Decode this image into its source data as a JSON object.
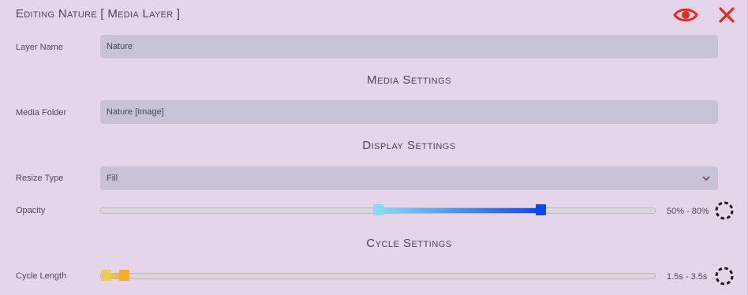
{
  "header": {
    "title": "Editing Nature [ Media Layer ]",
    "eye_icon": "eye-icon",
    "close_icon": "close-icon",
    "accent_color": "#e8291c"
  },
  "layer_name": {
    "label": "Layer Name",
    "value": "Nature"
  },
  "media_settings": {
    "title": "Media Settings",
    "media_folder": {
      "label": "Media Folder",
      "value": "Nature [Image]"
    }
  },
  "display_settings": {
    "title": "Display Settings",
    "resize_type": {
      "label": "Resize Type",
      "value": "Fill",
      "icon": "chevron-down-icon"
    },
    "opacity": {
      "label": "Opacity",
      "value_text": "50% - 80%",
      "min": 0,
      "max": 100,
      "low": 50,
      "high": 80,
      "low_color": "#86dcf4",
      "high_color": "#1146ee",
      "random_icon": "randomize-icon"
    }
  },
  "cycle_settings": {
    "title": "Cycle Settings",
    "cycle_length": {
      "label": "Cycle Length",
      "value_text": "1.5s - 3.5s",
      "low_fraction": 0.0,
      "high_fraction": 0.034,
      "low_color": "#e9cd5c",
      "high_color": "#f2ad2c",
      "random_icon": "randomize-icon"
    }
  }
}
